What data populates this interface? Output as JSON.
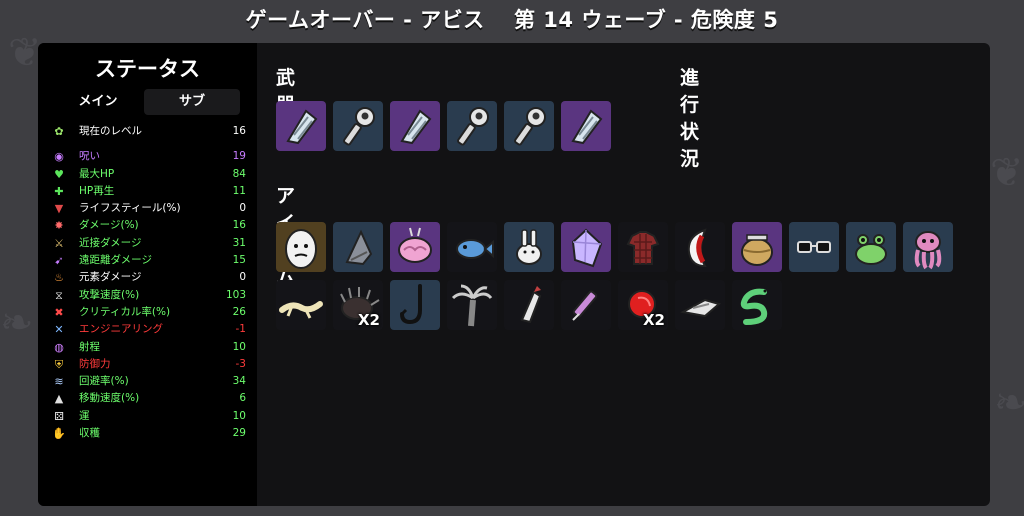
{
  "title": "ゲームオーバー - アビス　 第 14 ウェーブ - 危険度 5",
  "left": {
    "title": "ステータス",
    "tab_main": "メイン",
    "tab_sub": "サブ"
  },
  "stats": [
    {
      "label": "現在のレベル",
      "value": "16",
      "color": "#ffffff",
      "icon": "level-icon",
      "glyph": "✿",
      "iconColor": "#9be36a"
    },
    {
      "label": "呪い",
      "value": "19",
      "color": "#c77dff",
      "icon": "curse-icon",
      "glyph": "◉",
      "iconColor": "#c77dff"
    },
    {
      "label": "最大HP",
      "value": "84",
      "color": "#6dff6d",
      "icon": "heart-icon",
      "glyph": "♥",
      "iconColor": "#5ce65c"
    },
    {
      "label": "HP再生",
      "value": "11",
      "color": "#6dff6d",
      "icon": "regen-icon",
      "glyph": "✚",
      "iconColor": "#5ce65c"
    },
    {
      "label": "ライフスティール(%)",
      "value": "0",
      "color": "#ffffff",
      "icon": "lifesteal-icon",
      "glyph": "▼",
      "iconColor": "#e04a4a"
    },
    {
      "label": "ダメージ(%)",
      "value": "16",
      "color": "#6dff6d",
      "icon": "damage-icon",
      "glyph": "✸",
      "iconColor": "#ff6a6a"
    },
    {
      "label": "近接ダメージ",
      "value": "31",
      "color": "#6dff6d",
      "icon": "melee-icon",
      "glyph": "⚔",
      "iconColor": "#e0c070"
    },
    {
      "label": "遠距離ダメージ",
      "value": "15",
      "color": "#6dff6d",
      "icon": "ranged-icon",
      "glyph": "➹",
      "iconColor": "#c77dff"
    },
    {
      "label": "元素ダメージ",
      "value": "0",
      "color": "#ffffff",
      "icon": "elemental-icon",
      "glyph": "♨",
      "iconColor": "#ffa040"
    },
    {
      "label": "攻撃速度(%)",
      "value": "103",
      "color": "#6dff6d",
      "icon": "attack-speed-icon",
      "glyph": "⧖",
      "iconColor": "#e0e0e0"
    },
    {
      "label": "クリティカル率(%)",
      "value": "26",
      "color": "#6dff6d",
      "icon": "crit-icon",
      "glyph": "✖",
      "iconColor": "#ff4a4a"
    },
    {
      "label": "エンジニアリング",
      "value": "-1",
      "color": "#ff3b3b",
      "icon": "engineering-icon",
      "glyph": "✕",
      "iconColor": "#7fb8ff"
    },
    {
      "label": "射程",
      "value": "10",
      "color": "#6dff6d",
      "icon": "range-icon",
      "glyph": "◍",
      "iconColor": "#d080ff"
    },
    {
      "label": "防御力",
      "value": "-3",
      "color": "#ff3b3b",
      "icon": "armor-icon",
      "glyph": "⛨",
      "iconColor": "#ffd040"
    },
    {
      "label": "回避率(%)",
      "value": "34",
      "color": "#6dff6d",
      "icon": "dodge-icon",
      "glyph": "≋",
      "iconColor": "#b0d0ff"
    },
    {
      "label": "移動速度(%)",
      "value": "6",
      "color": "#6dff6d",
      "icon": "speed-icon",
      "glyph": "▲",
      "iconColor": "#e0e0e0"
    },
    {
      "label": "運",
      "value": "10",
      "color": "#6dff6d",
      "icon": "luck-icon",
      "glyph": "⚄",
      "iconColor": "#f0f0f0"
    },
    {
      "label": "収穫",
      "value": "29",
      "color": "#6dff6d",
      "icon": "harvest-icon",
      "glyph": "✋",
      "iconColor": "#e8c070"
    }
  ],
  "sections": {
    "weapons": "武器",
    "progress": "進行状況",
    "items": "アイテム"
  },
  "weapons": [
    {
      "icon": "claw-icon",
      "tier": "cursed"
    },
    {
      "icon": "wrench-icon",
      "tier": "blue"
    },
    {
      "icon": "claw-icon",
      "tier": "cursed"
    },
    {
      "icon": "wrench-icon",
      "tier": "blue"
    },
    {
      "icon": "wrench-icon",
      "tier": "blue"
    },
    {
      "icon": "claw-icon",
      "tier": "cursed"
    }
  ],
  "items": [
    {
      "icon": "egg-face-icon",
      "tier": "rare"
    },
    {
      "icon": "bullet-icon",
      "tier": "blue"
    },
    {
      "icon": "brain-icon",
      "tier": "cursed"
    },
    {
      "icon": "fish-icon",
      "tier": "dark"
    },
    {
      "icon": "rabbit-icon",
      "tier": "blue"
    },
    {
      "icon": "crystal-icon",
      "tier": "cursed"
    },
    {
      "icon": "shirt-icon",
      "tier": "dark"
    },
    {
      "icon": "mouth-icon",
      "tier": "dark"
    },
    {
      "icon": "fishbowl-icon",
      "tier": "cursed"
    },
    {
      "icon": "glasses-icon",
      "tier": "blue"
    },
    {
      "icon": "frog-icon",
      "tier": "blue"
    },
    {
      "icon": "octopus-icon",
      "tier": "blue"
    },
    {
      "icon": "lizard-icon",
      "tier": "dark"
    },
    {
      "icon": "hedgehog-icon",
      "tier": "dark",
      "count": "X2"
    },
    {
      "icon": "hook-icon",
      "tier": "blue"
    },
    {
      "icon": "palm-tree-icon",
      "tier": "dark"
    },
    {
      "icon": "missile-icon",
      "tier": "dark"
    },
    {
      "icon": "syringe-icon",
      "tier": "dark"
    },
    {
      "icon": "red-blob-icon",
      "tier": "dark",
      "count": "X2"
    },
    {
      "icon": "spaceship-icon",
      "tier": "dark"
    },
    {
      "icon": "snake-icon",
      "tier": "dark"
    }
  ],
  "colors": {
    "panel": "#121214",
    "tier_blue": "#2a3c4f",
    "tier_cursed": "#5a3580",
    "tier_rare": "#514020",
    "tier_dark": "#141418"
  }
}
